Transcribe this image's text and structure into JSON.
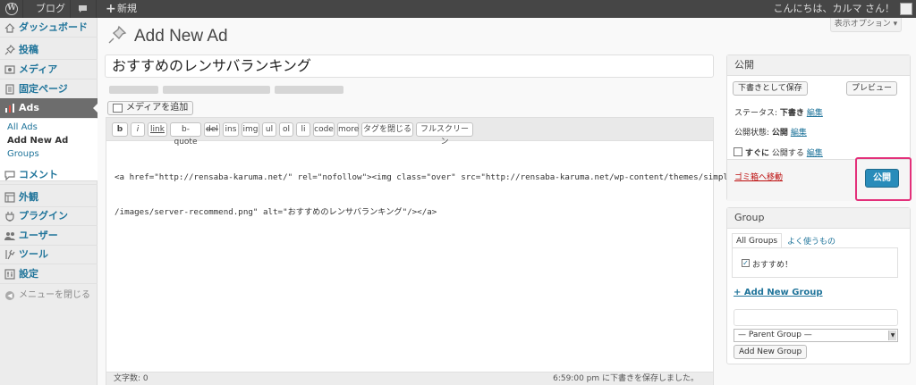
{
  "adminbar": {
    "site_name": "ブログ",
    "new_label": "新規",
    "greeting": "こんにちは、カルマ さん！"
  },
  "screen_options": "表示オプション ▾",
  "sidebar": {
    "items": [
      {
        "label": "ダッシュボード",
        "icon": "dashboard-icon"
      },
      {
        "label": "投稿",
        "icon": "pin-icon"
      },
      {
        "label": "メディア",
        "icon": "media-icon"
      },
      {
        "label": "固定ページ",
        "icon": "page-icon"
      },
      {
        "label": "Ads",
        "icon": "ads-icon"
      },
      {
        "label": "コメント",
        "icon": "comment-icon"
      },
      {
        "label": "外観",
        "icon": "appearance-icon"
      },
      {
        "label": "プラグイン",
        "icon": "plugin-icon"
      },
      {
        "label": "ユーザー",
        "icon": "users-icon"
      },
      {
        "label": "ツール",
        "icon": "tools-icon"
      },
      {
        "label": "設定",
        "icon": "settings-icon"
      }
    ],
    "submenu": [
      "All Ads",
      "Add New Ad",
      "Groups"
    ],
    "collapse_label": "メニューを閉じる"
  },
  "main": {
    "page_title": "Add New Ad",
    "title_value": "おすすめのレンサバランキング",
    "media_button": "メディアを追加",
    "quicktags": [
      "b",
      "i",
      "link",
      "b-quote",
      "del",
      "ins",
      "img",
      "ul",
      "ol",
      "li",
      "code",
      "more",
      "タグを閉じる",
      "フルスクリーン"
    ],
    "code_lines": [
      "<a href=\"http://rensaba-karuma.net/\" rel=\"nofollow\"><img class=\"over\" src=\"http://rensaba-karuma.net/wp-content/themes/simple",
      "/images/server-recommend.png\" alt=\"おすすめのレンサバランキング\"/></a>"
    ],
    "word_count": "文字数: 0",
    "saved_status": "6:59:00 pm に下書きを保存しました。"
  },
  "publish_box": {
    "title": "公開",
    "save_draft": "下書きとして保存",
    "preview": "プレビュー",
    "status_label": "ステータス:",
    "status_value": "下書き",
    "visibility_label": "公開状態:",
    "visibility_value": "公開",
    "schedule_value": "すぐに",
    "schedule_suffix": "公開する",
    "edit_label": "編集",
    "trash": "ゴミ箱へ移動",
    "publish": "公開"
  },
  "group_box": {
    "title": "Group",
    "tab_all": "All Groups",
    "tab_popular": "よく使うもの",
    "groups": [
      {
        "label": "おすすめ！",
        "checked": true
      }
    ],
    "add_link": "+ Add New Group",
    "parent_select": "— Parent Group —",
    "add_button": "Add New Group"
  },
  "colors": {
    "accent": "#21759b",
    "publish_button": "#298cba",
    "highlight": "#e3307a",
    "trash": "#bc0b0b"
  }
}
